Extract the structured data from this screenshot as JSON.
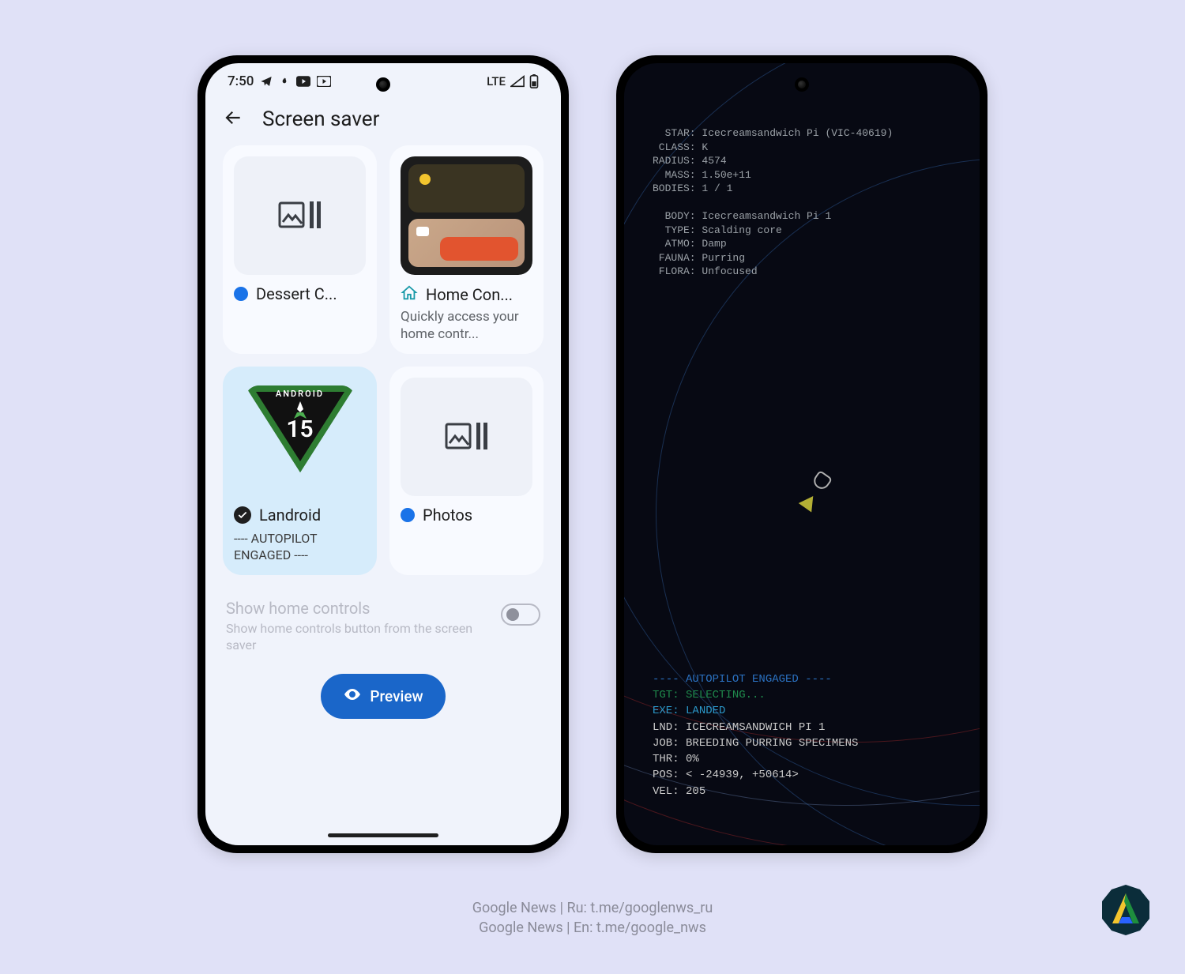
{
  "status": {
    "time": "7:50",
    "network": "LTE"
  },
  "page": {
    "title": "Screen saver"
  },
  "cards": [
    {
      "id": "dessert",
      "title": "Dessert C...",
      "selected": false
    },
    {
      "id": "home",
      "title": "Home Con...",
      "subtitle": "Quickly access your home contr...",
      "selected": false
    },
    {
      "id": "landroid",
      "title": "Landroid",
      "status": "---- AUTOPILOT ENGAGED ----",
      "selected": true,
      "badge_label": "ANDROID",
      "badge_version": "15"
    },
    {
      "id": "photos",
      "title": "Photos",
      "selected": false
    }
  ],
  "toggle": {
    "title": "Show home controls",
    "subtitle": "Show home controls button from the screen saver",
    "on": false
  },
  "preview_button": "Preview",
  "space": {
    "star": {
      "STAR": "Icecreamsandwich Pi (VIC-40619)",
      "CLASS": "K",
      "RADIUS": "4574",
      "MASS": "1.50e+11",
      "BODIES": "1 / 1"
    },
    "body": {
      "BODY": "Icecreamsandwich Pi 1",
      "TYPE": "Scalding core",
      "ATMO": "Damp",
      "FAUNA": "Purring",
      "FLORA": "Unfocused"
    },
    "console": {
      "autopilot": "---- AUTOPILOT ENGAGED ----",
      "TGT": "SELECTING...",
      "EXE": "LANDED",
      "LND": "ICECREAMSANDWICH PI 1",
      "JOB": "BREEDING PURRING SPECIMENS",
      "THR": "0%",
      "POS": "< -24939, +50614>",
      "VEL": "205"
    }
  },
  "footer": {
    "line1": "Google News | Ru: t.me/googlenws_ru",
    "line2": "Google News | En: t.me/google_nws"
  }
}
